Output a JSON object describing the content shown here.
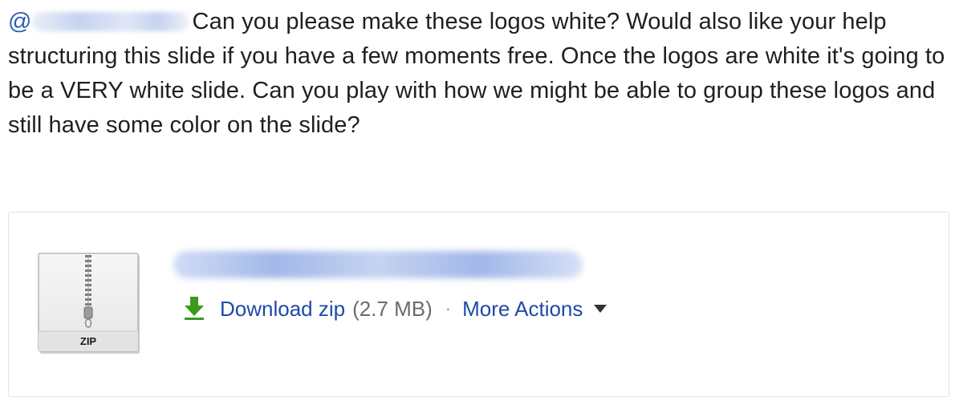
{
  "message": {
    "mention_at": "@",
    "text": "Can you please make these logos white? Would also like your help structuring this slide if you have a few moments free. Once the logos are white it's going to be a VERY white slide. Can you play with how we might be able to group these logos and still have some color on the slide?"
  },
  "attachment": {
    "icon": "zip-file-icon",
    "icon_label": "ZIP",
    "download_label": "Download zip",
    "file_size": "(2.7 MB)",
    "separator": "·",
    "more_actions_label": "More Actions"
  },
  "colors": {
    "link": "#1c4ba8",
    "download_arrow": "#3a9a1e",
    "card_border": "#e2e2e2"
  }
}
